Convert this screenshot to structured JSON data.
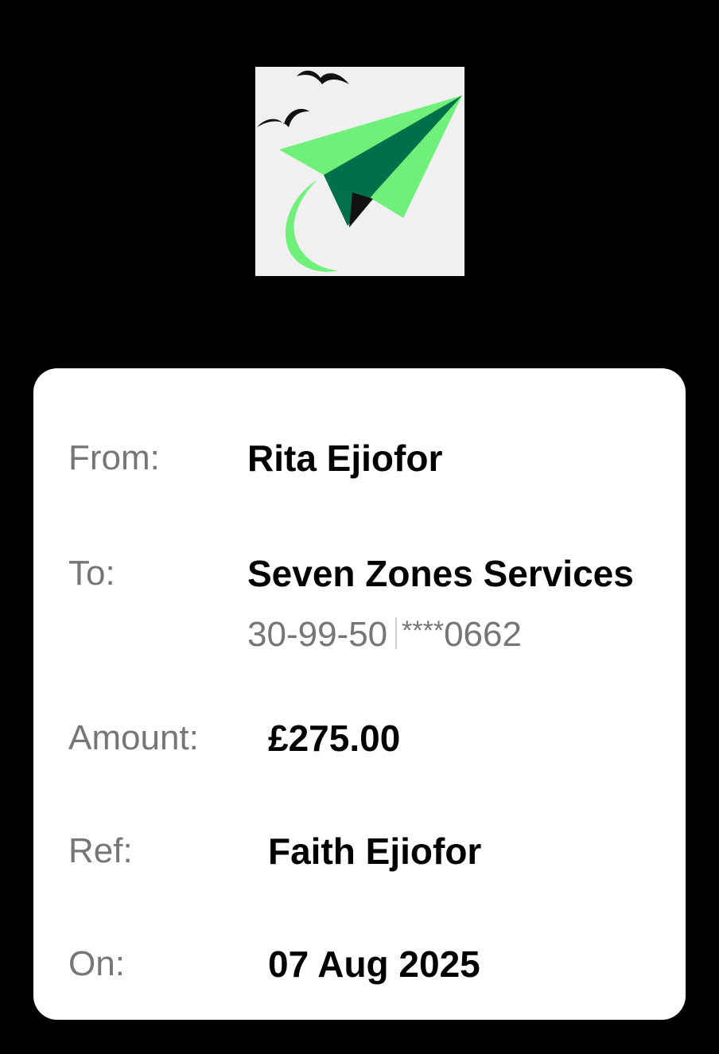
{
  "logo": {
    "colors": {
      "background": "#f0f0f0",
      "plane_light": "#6ff07a",
      "plane_dark": "#00704a",
      "birds": "#111111"
    }
  },
  "receipt": {
    "from": {
      "label": "From:",
      "value": "Rita Ejiofor"
    },
    "to": {
      "label": "To:",
      "value": "Seven Zones Services",
      "sort_code": "30-99-50",
      "account_mask": "****",
      "account_suffix": "0662"
    },
    "amount": {
      "label": "Amount:",
      "value": "£275.00"
    },
    "ref": {
      "label": "Ref:",
      "value": "Faith Ejiofor"
    },
    "on": {
      "label": "On:",
      "value": "07 Aug 2025"
    }
  },
  "colors": {
    "page_background": "#000000",
    "card_background": "#ffffff",
    "label_text": "#767676",
    "value_text": "#000000",
    "divider": "#c8d2dc"
  }
}
